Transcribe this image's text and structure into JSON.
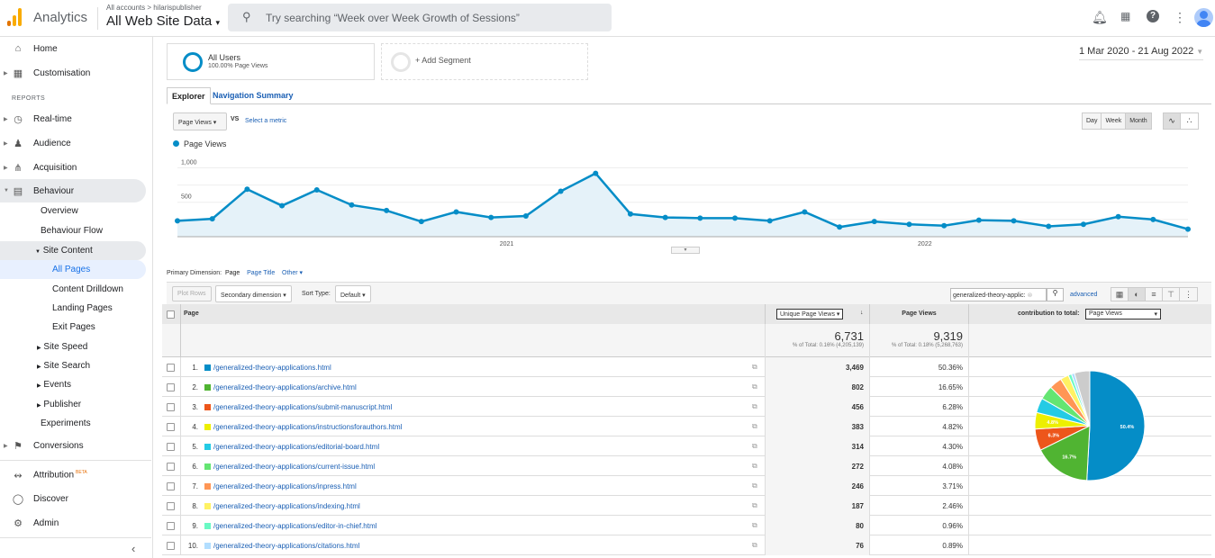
{
  "header": {
    "app_name": "Analytics",
    "breadcrumb": "All accounts > hilarispublisher",
    "property": "All Web Site Data",
    "search_placeholder": "Try searching “Week over Week Growth of Sessions”",
    "icons": [
      "bell-icon",
      "apps-icon",
      "help-icon",
      "more-icon",
      "avatar"
    ]
  },
  "sidebar": {
    "reports_label": "REPORTS",
    "items": [
      {
        "label": "Home"
      },
      {
        "label": "Customisation"
      },
      {
        "label": "Real-time"
      },
      {
        "label": "Audience"
      },
      {
        "label": "Acquisition"
      },
      {
        "label": "Behaviour"
      },
      {
        "label": "Overview"
      },
      {
        "label": "Behaviour Flow"
      },
      {
        "label": "Site Content"
      },
      {
        "label": "All Pages"
      },
      {
        "label": "Content Drilldown"
      },
      {
        "label": "Landing Pages"
      },
      {
        "label": "Exit Pages"
      },
      {
        "label": "Site Speed"
      },
      {
        "label": "Site Search"
      },
      {
        "label": "Events"
      },
      {
        "label": "Publisher"
      },
      {
        "label": "Experiments"
      },
      {
        "label": "Conversions"
      },
      {
        "label": "Attribution"
      },
      {
        "label": "Discover"
      },
      {
        "label": "Admin"
      }
    ],
    "beta": "BETA",
    "collapse": "‹"
  },
  "segments": {
    "all_users": "All Users",
    "all_users_sub": "100.00% Page Views",
    "add_segment": "+ Add Segment"
  },
  "date_range": "1 Mar 2020 - 21 Aug 2022",
  "tabs": [
    "Explorer",
    "Navigation Summary"
  ],
  "metric": {
    "selected": "Page Views",
    "vs": "VS",
    "select_metric": "Select a metric",
    "legend": "Page Views"
  },
  "granularity": [
    "Day",
    "Week",
    "Month"
  ],
  "chart_data": {
    "type": "line",
    "title": "",
    "series": [
      {
        "name": "Page Views",
        "values": [
          230,
          260,
          690,
          450,
          680,
          460,
          380,
          220,
          360,
          280,
          300,
          660,
          920,
          330,
          280,
          270,
          270,
          230,
          360,
          140,
          220,
          180,
          160,
          240,
          230,
          150,
          180,
          290,
          250,
          110
        ]
      }
    ],
    "x_ticks": [
      "2021",
      "2022"
    ],
    "y_ticks": [
      "500",
      "1,000"
    ],
    "ylim": [
      0,
      1150
    ]
  },
  "dimension": {
    "label": "Primary Dimension:",
    "page": "Page",
    "page_title": "Page Title",
    "other": "Other"
  },
  "toolbar": {
    "plot_rows": "Plot Rows",
    "secondary": "Secondary dimension",
    "sort_type": "Sort Type:",
    "sort_value": "Default",
    "filter_value": "generalized-theory-applic:",
    "advanced": "advanced"
  },
  "table": {
    "col_page": "Page",
    "col_unique": "Unique Page Views",
    "col_pv": "Page Views",
    "contribution_label": "contribution to total:",
    "contribution_metric": "Page Views",
    "total_unique": "6,731",
    "total_unique_sub": "% of Total: 0.16% (4,205,139)",
    "total_pv": "9,319",
    "total_pv_sub": "% of Total: 0.18% (5,268,763)",
    "rows": [
      {
        "n": "1.",
        "page": "/generalized-theory-applications.html",
        "unique": "3,469",
        "pct": "50.36%",
        "color": "#058dc7"
      },
      {
        "n": "2.",
        "page": "/generalized-theory-applications/archive.html",
        "unique": "802",
        "pct": "16.65%",
        "color": "#50b432"
      },
      {
        "n": "3.",
        "page": "/generalized-theory-applications/submit-manuscript.html",
        "unique": "456",
        "pct": "6.28%",
        "color": "#ed561b"
      },
      {
        "n": "4.",
        "page": "/generalized-theory-applications/instructionsforauthors.html",
        "unique": "383",
        "pct": "4.82%",
        "color": "#edef00"
      },
      {
        "n": "5.",
        "page": "/generalized-theory-applications/editorial-board.html",
        "unique": "314",
        "pct": "4.30%",
        "color": "#24cbe5"
      },
      {
        "n": "6.",
        "page": "/generalized-theory-applications/current-issue.html",
        "unique": "272",
        "pct": "4.08%",
        "color": "#64e572"
      },
      {
        "n": "7.",
        "page": "/generalized-theory-applications/inpress.html",
        "unique": "246",
        "pct": "3.71%",
        "color": "#ff9655"
      },
      {
        "n": "8.",
        "page": "/generalized-theory-applications/indexing.html",
        "unique": "187",
        "pct": "2.46%",
        "color": "#fff263"
      },
      {
        "n": "9.",
        "page": "/generalized-theory-applications/editor-in-chief.html",
        "unique": "80",
        "pct": "0.96%",
        "color": "#6af9c4"
      },
      {
        "n": "10.",
        "page": "/generalized-theory-applications/citations.html",
        "unique": "76",
        "pct": "0.89%",
        "color": "#b2deff"
      }
    ]
  },
  "pie": {
    "other_pct": 4.49,
    "other_color": "#cccccc",
    "labels": [
      "50.4%",
      "16.7%",
      "6.3%",
      "4.8%"
    ]
  }
}
